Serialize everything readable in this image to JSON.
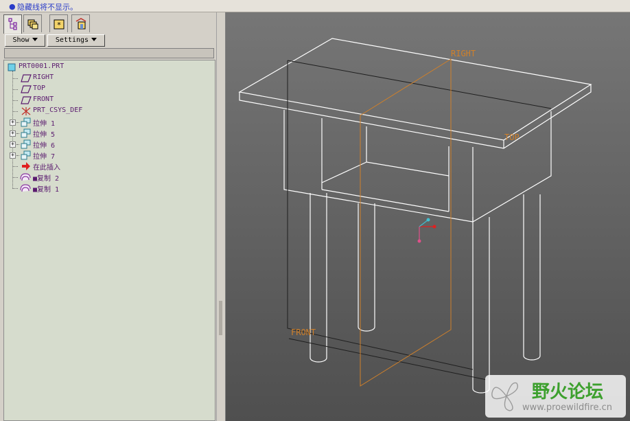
{
  "message": {
    "text": "隐藏线将不显示。"
  },
  "panel": {
    "tabs": [
      {
        "icon": "model-tree-icon",
        "active": true
      },
      {
        "icon": "folder-browser-icon",
        "active": false
      },
      {
        "icon": "favorites-icon",
        "active": false
      },
      {
        "icon": "connections-icon",
        "active": false
      }
    ],
    "show_label": "Show",
    "settings_label": "Settings"
  },
  "tree": {
    "root": "PRT0001.PRT",
    "items": [
      {
        "label": "RIGHT",
        "icon": "datum-plane-icon",
        "expandable": false
      },
      {
        "label": "TOP",
        "icon": "datum-plane-icon",
        "expandable": false
      },
      {
        "label": "FRONT",
        "icon": "datum-plane-icon",
        "expandable": false
      },
      {
        "label": "PRT_CSYS_DEF",
        "icon": "csys-icon",
        "expandable": false
      },
      {
        "label": "拉伸 1",
        "icon": "extrude-icon",
        "expandable": true
      },
      {
        "label": "拉伸 5",
        "icon": "extrude-icon",
        "expandable": true
      },
      {
        "label": "拉伸 6",
        "icon": "extrude-icon",
        "expandable": true
      },
      {
        "label": "拉伸 7",
        "icon": "extrude-icon",
        "expandable": true
      },
      {
        "label": "在此插入",
        "icon": "insert-here-arrow-icon",
        "expandable": false
      },
      {
        "label": "■复制 2",
        "icon": "copy-feature-icon",
        "expandable": false
      },
      {
        "label": "■复制 1",
        "icon": "copy-feature-icon",
        "expandable": false
      }
    ]
  },
  "viewport": {
    "labels": {
      "right": "RIGHT",
      "top": "TOP",
      "front": "FRONT"
    },
    "colors": {
      "background": "#5f5f5f",
      "edges": "#ffffff",
      "datum": "#d0802a",
      "hidden": "#1e1e1e"
    }
  },
  "watermark": {
    "title": "野火论坛",
    "url": "www.proewildfire.cn"
  }
}
